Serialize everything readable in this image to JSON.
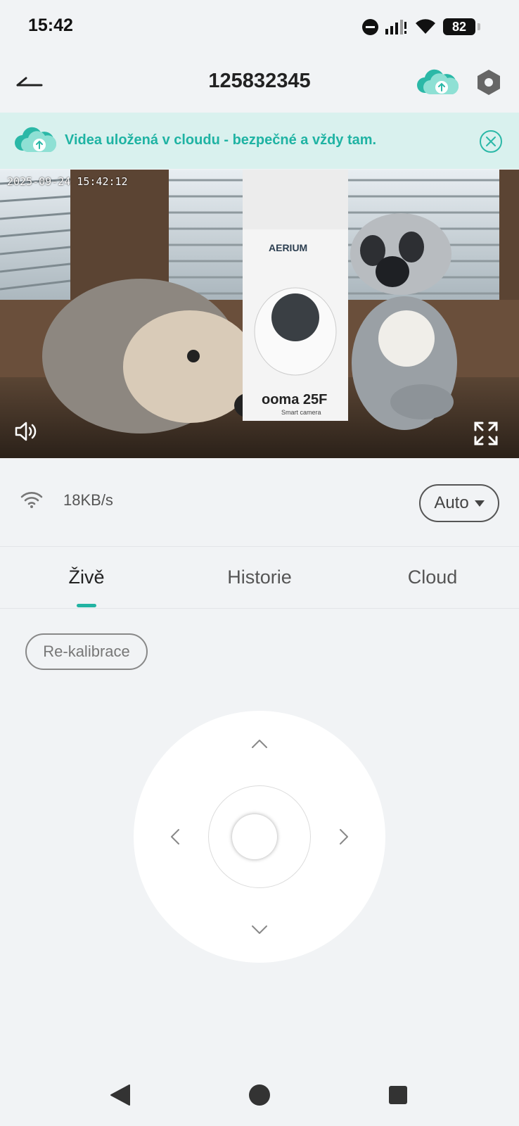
{
  "status_bar": {
    "time": "15:42",
    "battery": "82"
  },
  "header": {
    "title": "125832345"
  },
  "banner": {
    "text": "Videa uložená v cloudu - bezpečné a vždy tam."
  },
  "video": {
    "timestamp": "2025-09-24 15:42:12",
    "box_brand": "AERIUM",
    "box_product": "ooma 25F",
    "box_subtitle": "Smart camera"
  },
  "stream": {
    "speed": "18KB/s",
    "quality": "Auto"
  },
  "tabs": [
    {
      "label": "Živě",
      "active": true
    },
    {
      "label": "Historie",
      "active": false
    },
    {
      "label": "Cloud",
      "active": false
    }
  ],
  "controls": {
    "recalibrate_label": "Re-kalibrace"
  },
  "colors": {
    "accent": "#22b3a2",
    "banner_bg": "#d9f1ee",
    "background": "#f1f3f5"
  },
  "icons": {
    "back": "back-arrow-icon",
    "cloud_upload": "cloud-upload-icon",
    "settings": "settings-hexagon-icon",
    "close": "close-circle-icon",
    "mute": "speaker-icon",
    "fullscreen": "fullscreen-icon",
    "wifi": "wifi-icon"
  }
}
